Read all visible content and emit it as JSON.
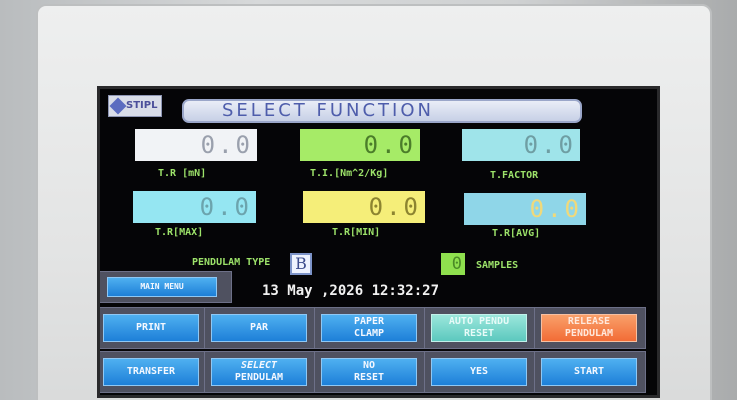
{
  "logo": {
    "text": "STIPL"
  },
  "title": "SELECT FUNCTION",
  "readouts": [
    {
      "value": "0.0",
      "label": "T.R [mN]",
      "bg": "#f1f3f6",
      "fg": "#9aa0ad"
    },
    {
      "value": "0.0",
      "label": "T.I.[Nm^2/Kg]",
      "bg": "#a6eb67",
      "fg": "#4b7d2a"
    },
    {
      "value": "0.0",
      "label": "T.FACTOR",
      "bg": "#9fe4ea",
      "fg": "#6f9ea3"
    },
    {
      "value": "0.0",
      "label": "T.R[MAX]",
      "bg": "#95e6f2",
      "fg": "#6ca4ad"
    },
    {
      "value": "0.0",
      "label": "T.R[MIN]",
      "bg": "#f5ee79",
      "fg": "#8c8430"
    },
    {
      "value": "0.0",
      "label": "T.R[AVG]",
      "bg": "#8fd6e8",
      "fg": "#f0d97a"
    }
  ],
  "pendulam": {
    "label": "PENDULAM TYPE",
    "value": "B"
  },
  "samples": {
    "value": "0",
    "label": "SAMPLES"
  },
  "main_menu": "MAIN MENU",
  "datetime": "13 May ,2026 12:32:27",
  "buttons_row1": [
    {
      "l1": "PRINT",
      "l2": "",
      "style": "blue"
    },
    {
      "l1": "PAR",
      "l2": "",
      "style": "blue"
    },
    {
      "l1": "PAPER",
      "l2": "CLAMP",
      "style": "blue"
    },
    {
      "l1": "AUTO PENDU",
      "l2": "RESET",
      "style": "teal"
    },
    {
      "l1": "RELEASE",
      "l2": "PENDULAM",
      "style": "orange"
    }
  ],
  "buttons_row2": [
    {
      "l1": "TRANSFER",
      "l2": "",
      "style": "blue"
    },
    {
      "l1": "SELECT",
      "l2": "PENDULAM",
      "style": "blue"
    },
    {
      "l1": "NO",
      "l2": "RESET",
      "style": "blue"
    },
    {
      "l1": "YES",
      "l2": "",
      "style": "blue"
    },
    {
      "l1": "START",
      "l2": "",
      "style": "blue"
    }
  ]
}
